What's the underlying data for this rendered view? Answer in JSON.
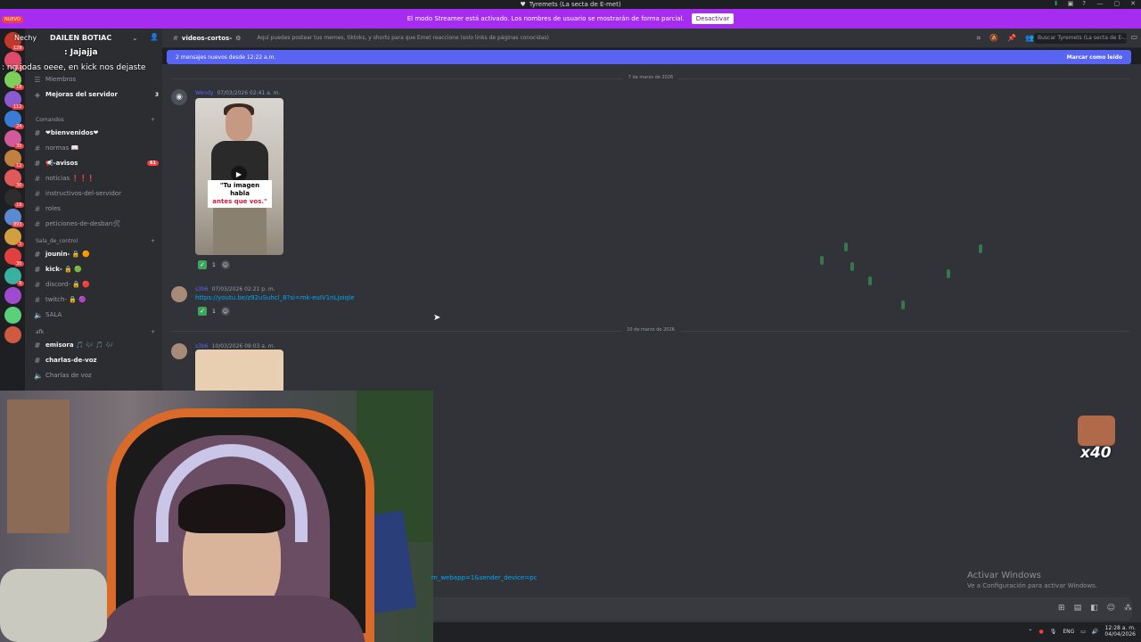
{
  "window": {
    "title": "Tyremets (La secta de E-met)",
    "title_icon": "discord-logo-icon"
  },
  "streamer_banner": {
    "message": "El modo Streamer está activado. Los nombres de usuario se mostrarán de forma parcial.",
    "button": "Desactivar"
  },
  "server_rail": {
    "badges": [
      "128",
      "12",
      "18",
      "112",
      "24",
      "30",
      "12",
      "30",
      "19",
      "893",
      "1",
      "30",
      "6"
    ]
  },
  "sidebar": {
    "server_name": "DAILEN BOTIAC",
    "items": [
      {
        "label": "Miembros",
        "icon": "members-icon"
      },
      {
        "label": "Mejoras del servidor",
        "icon": "boost-icon",
        "num": "3"
      }
    ],
    "categories": [
      {
        "label": "Comandos",
        "channels": [
          {
            "label": "❤bienvenidos❤",
            "bold": true
          },
          {
            "label": "normas 📖",
            "bold": false
          },
          {
            "label": "📢-avisos",
            "bold": true,
            "count": "61"
          },
          {
            "label": "noticias ❗❗❗",
            "bold": false
          },
          {
            "label": "instructivos-del-servidor",
            "bold": false
          },
          {
            "label": "roles",
            "bold": false
          },
          {
            "label": "peticiones-de-desban🛠",
            "bold": false
          }
        ]
      },
      {
        "label": "Sala_de_control",
        "channels": [
          {
            "label": "jounin- 🔒 🟠",
            "bold": true
          },
          {
            "label": "kick- 🔒 🟢",
            "bold": true
          },
          {
            "label": "discord- 🔒 🔴",
            "bold": false
          },
          {
            "label": "twitch- 🔒 🟣",
            "bold": false
          },
          {
            "label": "SALA",
            "bold": false,
            "icon": "speaker-icon"
          }
        ]
      },
      {
        "label": "afk",
        "channels": [
          {
            "label": "emisora 🎵 🎶 🎵 🎶",
            "bold": true
          },
          {
            "label": "charlas-de-voz",
            "bold": true
          },
          {
            "label": "Charlas de voz",
            "bold": false,
            "icon": "speaker-icon"
          }
        ]
      }
    ]
  },
  "overlay_chat": {
    "nuevo": "NUEVO",
    "line1": "Nechy",
    "line2": ": Jajajja",
    "line3": ": ng jodas oeee, en kick nos dejaste"
  },
  "header": {
    "channel": "videos-cortos-",
    "topic": "Aquí puedes postear tus memes, tiktoks, y shorts para que Emet reaccione (solo links de páginas conocidas)",
    "search_placeholder": "Buscar Tyremets (La secta de E-..."
  },
  "new_messages": {
    "text": "2 mensajes nuevos desde 12:22 a.m.",
    "mark": "Marcar como leído"
  },
  "messages": {
    "divider1": "7 de marzo de 2026",
    "msg1": {
      "author": "Wendy",
      "timestamp": "07/03/2026 02:41 a. m.",
      "video_caption_1": "\"Tu imagen habla",
      "video_caption_2": "antes que vos.\"",
      "reaction_count": "1"
    },
    "msg2": {
      "author": "s3b6",
      "timestamp": "07/03/2026 02:21 p. m.",
      "link": "https://youtu.be/z92uSuhcl_8?si=mk-euIV1nLjoiqle",
      "reaction_count": "1"
    },
    "divider2": "10 de marzo de 2026",
    "msg3": {
      "author": "s3b6",
      "timestamp": "10/03/2026 09:03 a. m."
    }
  },
  "overlay": {
    "emote_count": "x40",
    "url_fragment": "m_webapp=1&sender_device=pc"
  },
  "activate_windows": {
    "title": "Activar Windows",
    "subtitle": "Ve a Configuración para activar Windows."
  },
  "taskbar": {
    "lang": "ENG",
    "time": "12:28 a. m.",
    "date": "04/04/2026"
  }
}
